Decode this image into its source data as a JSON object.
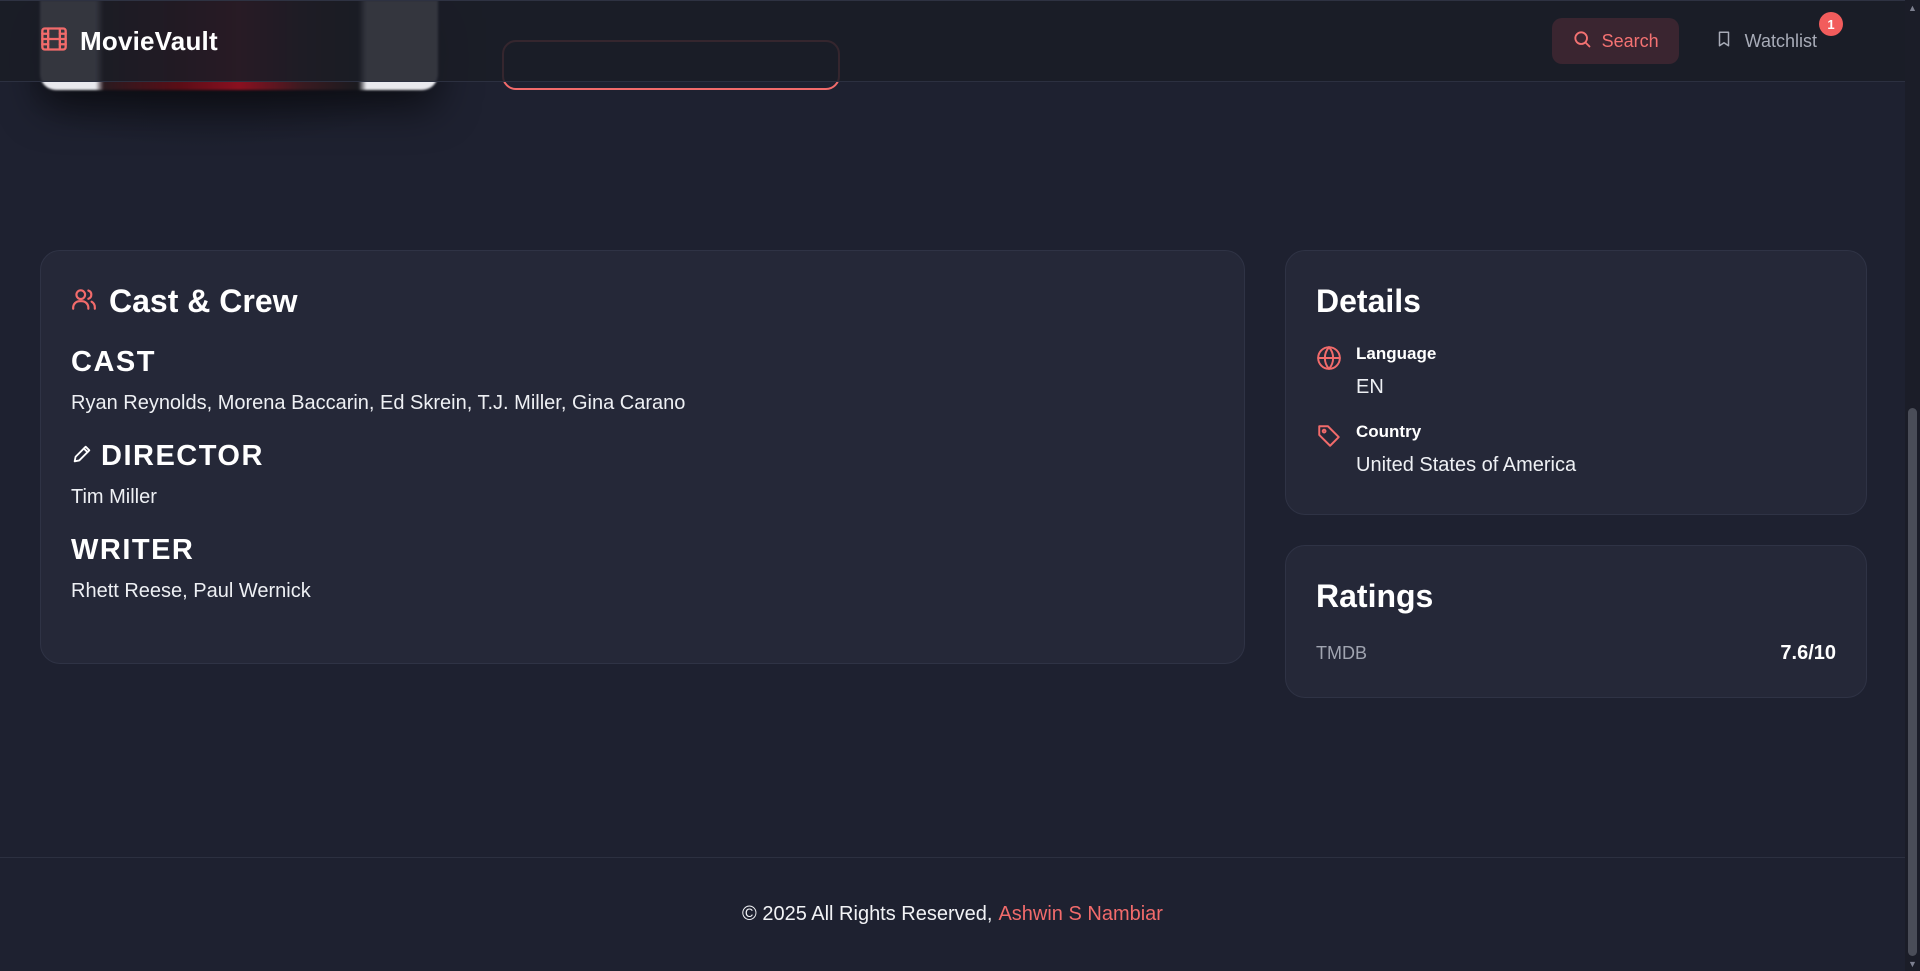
{
  "navbar": {
    "brand": "MovieVault",
    "search_label": "Search",
    "watchlist_label": "Watchlist",
    "watchlist_count": "1"
  },
  "cast_crew": {
    "title": "Cast & Crew",
    "cast_heading": "CAST",
    "cast": "Ryan Reynolds, Morena Baccarin, Ed Skrein, T.J. Miller, Gina Carano",
    "director_heading": "DIRECTOR",
    "director": "Tim Miller",
    "writer_heading": "WRITER",
    "writer": "Rhett Reese, Paul Wernick"
  },
  "details": {
    "title": "Details",
    "language_label": "Language",
    "language_value": "EN",
    "country_label": "Country",
    "country_value": "United States of America"
  },
  "ratings": {
    "title": "Ratings",
    "source": "TMDB",
    "value": "7.6/10"
  },
  "footer": {
    "copyright": "© 2025 All Rights Reserved,",
    "author": "Ashwin S Nambiar"
  },
  "colors": {
    "accent": "#f26b6b",
    "background": "#1e2130",
    "card": "#252838"
  },
  "icons": {
    "brand": "film-icon",
    "search": "search-icon",
    "watchlist": "bookmark-icon",
    "cast_crew": "users-icon",
    "director": "pencil-icon",
    "language": "globe-icon",
    "country": "tag-icon"
  }
}
